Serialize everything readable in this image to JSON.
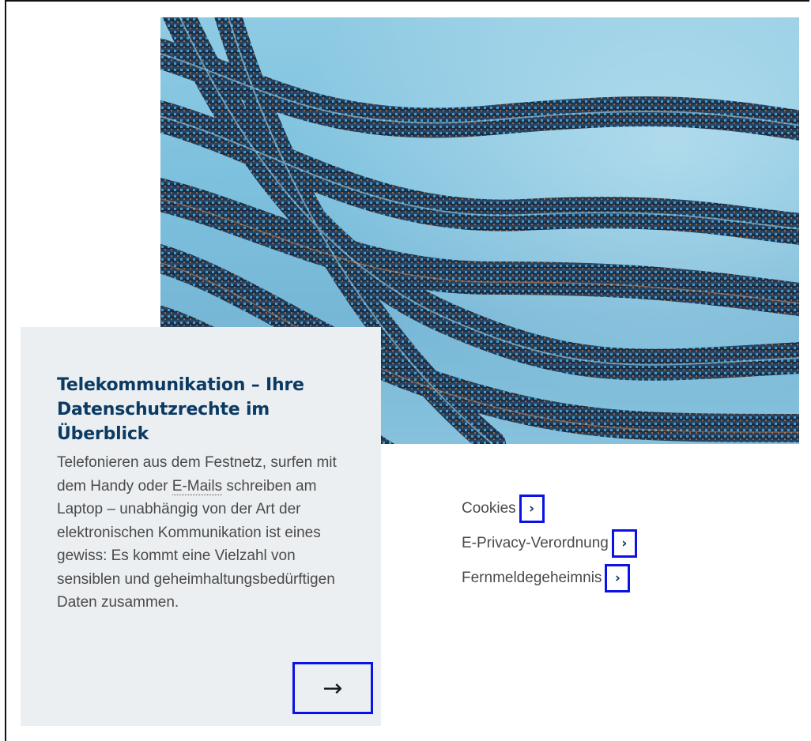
{
  "teaser": {
    "title": "Telekommunikation – Ihre Datenschutzrechte im Überblick",
    "text_before_abbr": "Telefonieren aus dem Festnetz, surfen mit dem Handy oder ",
    "abbr": "E-Mails",
    "text_after_abbr": " schreiben am Laptop – unabhängig von der Art der elektronischen Kommunikation ist eines gewiss: Es kommt eine Vielzahl von sensiblen und geheimhaltungsbedürftigen Daten zusammen.",
    "arrow": "→"
  },
  "related_links": [
    {
      "label": "Cookies",
      "chevron": "›"
    },
    {
      "label": "E-Privacy-Verordnung",
      "chevron": "›"
    },
    {
      "label": "Fernmeldegeheimnis",
      "chevron": "›"
    }
  ],
  "colors": {
    "title": "#0b3a63",
    "highlight_box": "#0a12e6",
    "card_bg": "#eceff1"
  },
  "hero_image": {
    "icon": "fiber-optic-cables-image"
  }
}
